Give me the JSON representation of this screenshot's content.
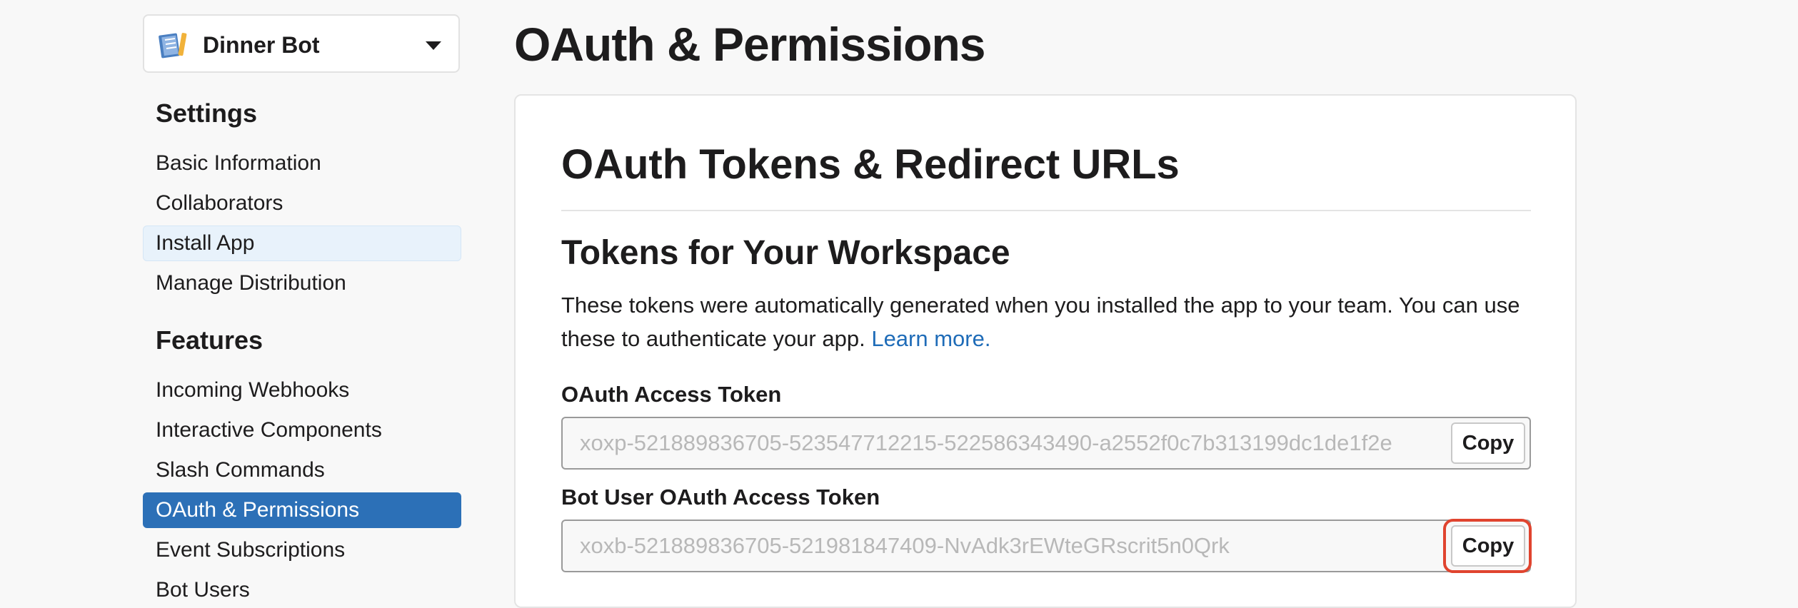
{
  "app": {
    "name": "Dinner Bot",
    "icon": "app-book-icon"
  },
  "sidebar": {
    "settings_title": "Settings",
    "settings_items": [
      {
        "label": "Basic Information"
      },
      {
        "label": "Collaborators"
      },
      {
        "label": "Install App",
        "state": "hover"
      },
      {
        "label": "Manage Distribution"
      }
    ],
    "features_title": "Features",
    "features_items": [
      {
        "label": "Incoming Webhooks"
      },
      {
        "label": "Interactive Components"
      },
      {
        "label": "Slash Commands"
      },
      {
        "label": "OAuth & Permissions",
        "state": "active"
      },
      {
        "label": "Event Subscriptions"
      },
      {
        "label": "Bot Users"
      }
    ]
  },
  "page": {
    "title": "OAuth & Permissions"
  },
  "card": {
    "title": "OAuth Tokens & Redirect URLs",
    "section_title": "Tokens for Your Workspace",
    "description": "These tokens were automatically generated when you installed the app to your team. You can use these to authenticate your app.",
    "learn_more": "Learn more.",
    "oauth_token": {
      "label": "OAuth Access Token",
      "value": "xoxp-521889836705-523547712215-522586343490-a2552f0c7b313199dc1de1f2e",
      "copy_label": "Copy"
    },
    "bot_token": {
      "label": "Bot User OAuth Access Token",
      "value": "xoxb-521889836705-521981847409-NvAdk3rEWteGRscrit5n0Qrk",
      "copy_label": "Copy"
    }
  },
  "colors": {
    "accent": "#2c70b7",
    "link": "#1f6cb8",
    "highlight": "#e0442f"
  }
}
